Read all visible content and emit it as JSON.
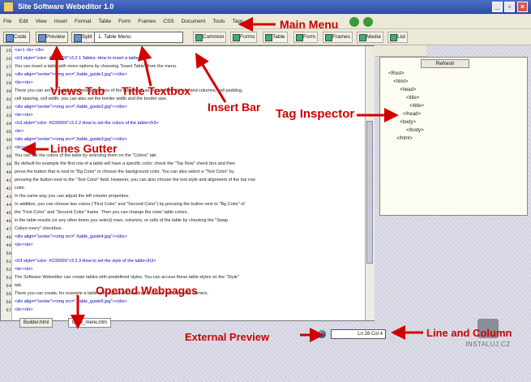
{
  "window": {
    "title": "Site Software Webeditor 1.0",
    "min": "_",
    "max": "▫",
    "close": "×"
  },
  "menu": [
    "File",
    "Edit",
    "View",
    "Insert",
    "Format",
    "Table",
    "Form",
    "Frames",
    "CSS",
    "Document",
    "Tools",
    "Tags"
  ],
  "toolbar": {
    "views_tabs": [
      "Code",
      "Preview",
      "Split"
    ],
    "title_textbox": "1. Table Menu"
  },
  "insert_tabs": [
    "Common",
    "Forms",
    "Table",
    "Form",
    "Frames",
    "Media",
    "List"
  ],
  "code_lines": [
    {
      "n": "25",
      "t": "<a>1 <b> </b>"
    },
    {
      "n": "26",
      "t": "<h3 style=\"color: #C00000\">3.2.1 Tables: How to insert a table</h3>"
    },
    {
      "n": "27",
      "t": "You can insert a table with more options by choosing \"Insert Table\" from the menu."
    },
    {
      "n": "28",
      "t": "<div align=\"center\"><img src=\"./table_guide1.jpg\"></div>"
    },
    {
      "n": "29",
      "t": "<br><br>"
    },
    {
      "n": "30",
      "t": "There you can set the border or more properties of the table such as the number of rows and columns, cell padding,"
    },
    {
      "n": "31",
      "t": "cell spacing, cell width, you can also set the border width and the border size."
    },
    {
      "n": "32",
      "t": "<div align=\"center\"><img src=\"./table_guide2.jpg\"></div>"
    },
    {
      "n": "33",
      "t": "<br><br>"
    },
    {
      "n": "34",
      "t": "<h3 style=\"color: #C00000\">3.2.2 How to set the colors of the table</h3>"
    },
    {
      "n": "35",
      "t": "<br>"
    },
    {
      "n": "36",
      "t": "<div align=\"center\"><img src=\"./table_guide3.jpg\"></div>"
    },
    {
      "n": "37",
      "t": "<br><br>"
    },
    {
      "n": "38",
      "t": "You can set the colors of the table by selecting them on the \"Colors\" tab."
    },
    {
      "n": "39",
      "t": "By default for example the first row of a table will have a specific color: check the \"Top Row\" check box and then"
    },
    {
      "n": "40",
      "t": "press the button that is next to \"Bg Color\" to choose the background color. You can also select a \"Text Color\" by"
    },
    {
      "n": "41",
      "t": "pressing the button next to the \"Text Color\" field. However, you can also choose the text style and alignment of the top row"
    },
    {
      "n": "42",
      "t": "color."
    },
    {
      "n": "43",
      "t": "In the same way you can adjust the left column properties."
    },
    {
      "n": "44",
      "t": "In addition, you can choose two colors (\"First Color\" and \"Second Color\") by pressing the button next to \"Bg Color\" of"
    },
    {
      "n": "45",
      "t": "the \"First Color\" and \"Second Color\" frame. Then you can change the rows' table colors,"
    },
    {
      "n": "46",
      "t": "in the table results (or any other items you select) rows, columns, or cells of the table by checking the \"Swap"
    },
    {
      "n": "47",
      "t": "Colors every\" checkbox."
    },
    {
      "n": "48",
      "t": "<div align=\"center\"><img src=\"./table_guide4.jpg\"></div>"
    },
    {
      "n": "49",
      "t": "<br><br>"
    },
    {
      "n": "50",
      "t": ""
    },
    {
      "n": "51",
      "t": "<h3 style=\"color: #C00000\">3.2.3 How to set the style of the table</h3>"
    },
    {
      "n": "52",
      "t": "<br><br>"
    },
    {
      "n": "53",
      "t": "The Software Webeditor can create tables with predefined styles. You can access these table styles on the \"Style\""
    },
    {
      "n": "54",
      "t": "tab."
    },
    {
      "n": "55",
      "t": "There you can create, for example a table with a gradient heading or a table with rounded corners."
    },
    {
      "n": "56",
      "t": "<div align=\"center\"><img src=\"./table_guide5.jpg\"></div>"
    },
    {
      "n": "57",
      "t": "<br><br>"
    }
  ],
  "doc_tabs": [
    "Builder.html",
    "table_menu.htm"
  ],
  "inspector": {
    "refresh": "Refresh",
    "tree": [
      "<Root>",
      "<html>",
      "<head>",
      "<title>",
      "</title>",
      "</head>",
      "<body>",
      "</body>",
      "</html>"
    ]
  },
  "status": {
    "line_col": "Ln 28 Col 4"
  },
  "annotations": {
    "main_menu": "Main Menu",
    "views_tab": "Views Tab",
    "title_textbox": "Title Textbox",
    "insert_bar": "Insert Bar",
    "tag_inspector": "Tag Inspector",
    "lines_gutter": "Lines Gutter",
    "opened_webpages": "Opened Webpages",
    "external_preview": "External Preview",
    "line_and_column": "Line and Column"
  },
  "watermark": "INSTALUJ.CZ",
  "colors": {
    "annotation": "#d00000",
    "titlebar": "#2d4fa8",
    "tag": "#0000c0",
    "attr": "#aa0000"
  }
}
